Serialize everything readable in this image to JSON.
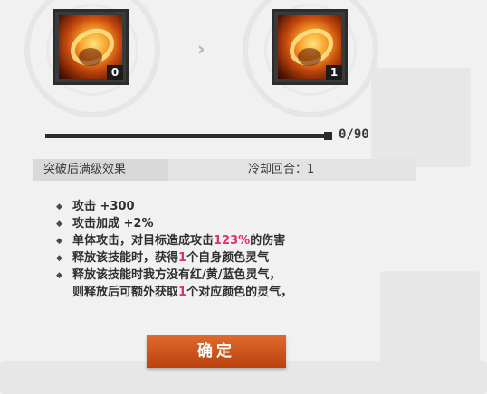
{
  "skill_current": {
    "level": "0",
    "icon": "fire-dragon-icon"
  },
  "skill_next": {
    "level": "1",
    "icon": "fire-dragon-icon"
  },
  "progress": {
    "current": 0,
    "max": 90,
    "label": "0/90"
  },
  "header": {
    "left": "突破后满级效果",
    "right": "冷却回合：1"
  },
  "effects": [
    {
      "parts": [
        {
          "text": "攻击 +300"
        }
      ]
    },
    {
      "parts": [
        {
          "text": "攻击加成 +2%"
        }
      ]
    },
    {
      "parts": [
        {
          "text": "单体攻击，对目标造成攻击"
        },
        {
          "text": "123%",
          "hl": true
        },
        {
          "text": "的伤害"
        }
      ]
    },
    {
      "parts": [
        {
          "text": "释放该技能时，获得"
        },
        {
          "text": "1",
          "hl": true
        },
        {
          "text": "个自身颜色灵气"
        }
      ]
    },
    {
      "parts": [
        {
          "text": "释放该技能时我方没有红/黄/蓝色灵气，"
        }
      ]
    },
    {
      "parts": [
        {
          "text": "则释放后可额外获取"
        },
        {
          "text": "1",
          "hl": true
        },
        {
          "text": "个对应颜色的灵气，"
        }
      ]
    }
  ],
  "confirm_label": "确定",
  "colors": {
    "highlight": "#e0306a",
    "button": "#c9521a"
  }
}
